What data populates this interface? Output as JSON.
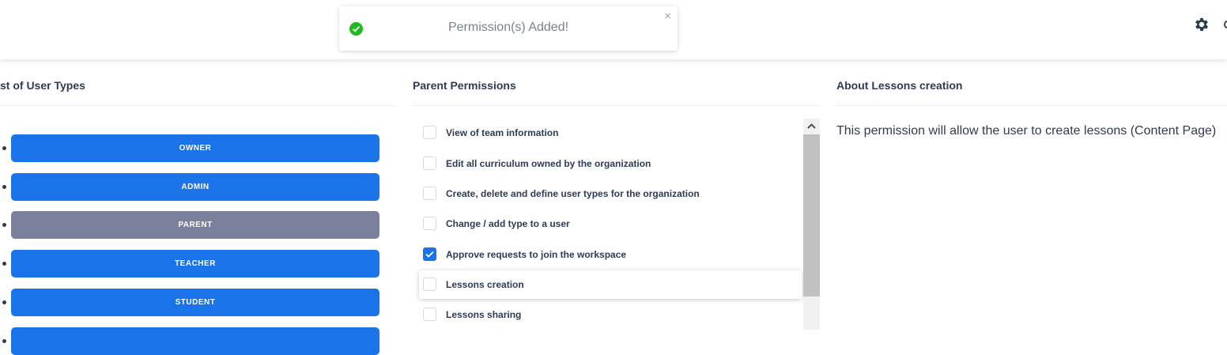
{
  "toast": {
    "message": "Permission(s) Added!",
    "close_glyph": "×",
    "icon": "check-circle-icon",
    "icon_color": "#1db91d"
  },
  "header": {
    "settings_icon": "gear-icon"
  },
  "columns": {
    "user_types_title": "st of User Types",
    "permissions_title": "Parent Permissions",
    "about_title": "About Lessons creation"
  },
  "user_types": [
    {
      "label": "OWNER",
      "selected": false
    },
    {
      "label": "ADMIN",
      "selected": false
    },
    {
      "label": "PARENT",
      "selected": true
    },
    {
      "label": "TEACHER",
      "selected": false
    },
    {
      "label": "STUDENT",
      "selected": false
    }
  ],
  "permissions": [
    {
      "label": "View of team information",
      "checked": false
    },
    {
      "label": "Edit all curriculum owned by the organization",
      "checked": false
    },
    {
      "label": "Create, delete and define user types for the organization",
      "checked": false
    },
    {
      "label": "Change / add type to a user",
      "checked": false
    },
    {
      "label": "Approve requests to join the workspace",
      "checked": true
    },
    {
      "label": "Lessons creation",
      "checked": false,
      "hovered": true
    },
    {
      "label": "Lessons sharing",
      "checked": false
    }
  ],
  "about": {
    "description": "This permission will allow the user to create lessons (Content Page)"
  },
  "colors": {
    "primary": "#1a73e8",
    "selected_type": "#7b819c",
    "text": "#2f3a55"
  }
}
